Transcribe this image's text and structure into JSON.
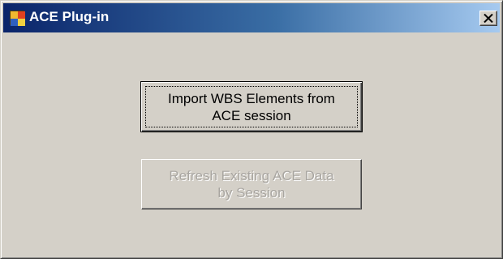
{
  "window": {
    "title": "ACE Plug-in",
    "icon": "app-windows-icon",
    "close_label": "close-icon"
  },
  "buttons": {
    "import_label": "Import WBS Elements from\nACE session",
    "refresh_label": "Refresh Existing ACE Data\nby Session",
    "refresh_enabled": false
  },
  "colors": {
    "titlebar_start": "#0a246a",
    "titlebar_end": "#a6caf0",
    "face": "#d4d0c8",
    "disabled_text": "#a8a5a0"
  }
}
